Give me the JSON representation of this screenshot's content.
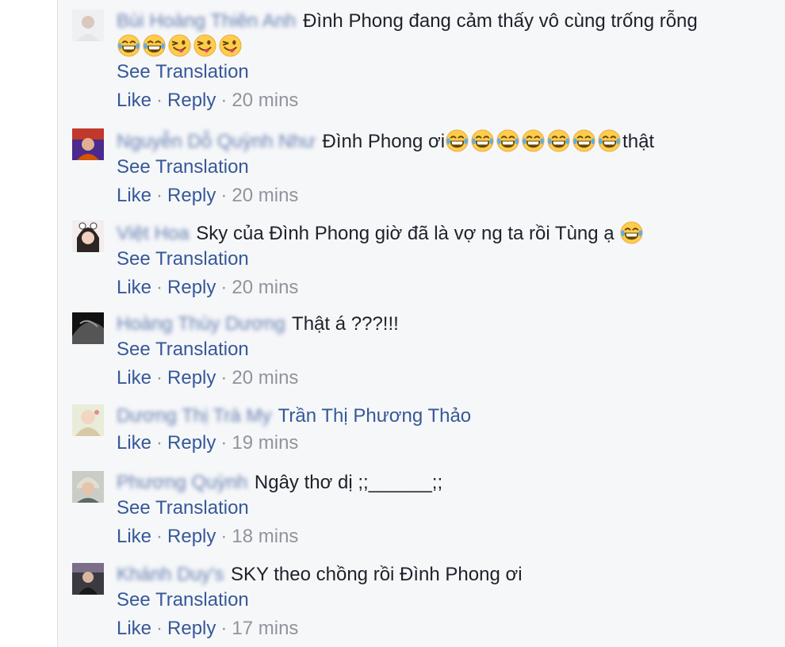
{
  "comments": [
    {
      "author": "Bùi Hoàng Thiên Anh",
      "text": "Đình Phong đang cảm thấy vô cùng trống rỗng",
      "emojis": [
        "joy",
        "joy",
        "wink-tongue",
        "wink-tongue",
        "wink-tongue"
      ],
      "see_translation": "See Translation",
      "like": "Like",
      "reply": "Reply",
      "time": "20 mins"
    },
    {
      "author": "Nguyễn Dỗ Quỳnh Như",
      "text": "Đình Phong ơi",
      "emojis": [
        "joy",
        "joy",
        "joy",
        "joy",
        "joy",
        "joy",
        "joy"
      ],
      "text_after": "thật",
      "see_translation": "See Translation",
      "like": "Like",
      "reply": "Reply",
      "time": "20 mins"
    },
    {
      "author": "Việt Hoa",
      "text": "Sky của Đình Phong giờ đã là vợ ng ta rồi Tùng ạ",
      "emojis": [
        "joy"
      ],
      "see_translation": "See Translation",
      "like": "Like",
      "reply": "Reply",
      "time": "20 mins"
    },
    {
      "author": "Hoàng Thùy Dương",
      "text": "Thật á ???!!!",
      "see_translation": "See Translation",
      "like": "Like",
      "reply": "Reply",
      "time": "20 mins"
    },
    {
      "author": "Dương Thị Trà My",
      "tag": "Trần Thị Phương Thảo",
      "like": "Like",
      "reply": "Reply",
      "time": "19 mins"
    },
    {
      "author": "Phương Quỳnh",
      "text": "Ngây thơ dị ;;______;;",
      "see_translation": "See Translation",
      "like": "Like",
      "reply": "Reply",
      "time": "18 mins"
    },
    {
      "author": "Khánh Duy's",
      "text": "SKY theo chồng rồi Đình Phong ơi",
      "see_translation": "See Translation",
      "like": "Like",
      "reply": "Reply",
      "time": "17 mins"
    }
  ],
  "separator": "·",
  "colors": {
    "link": "#365899",
    "text": "#1d2129",
    "meta": "#90949c",
    "background": "#f6f7f9"
  }
}
